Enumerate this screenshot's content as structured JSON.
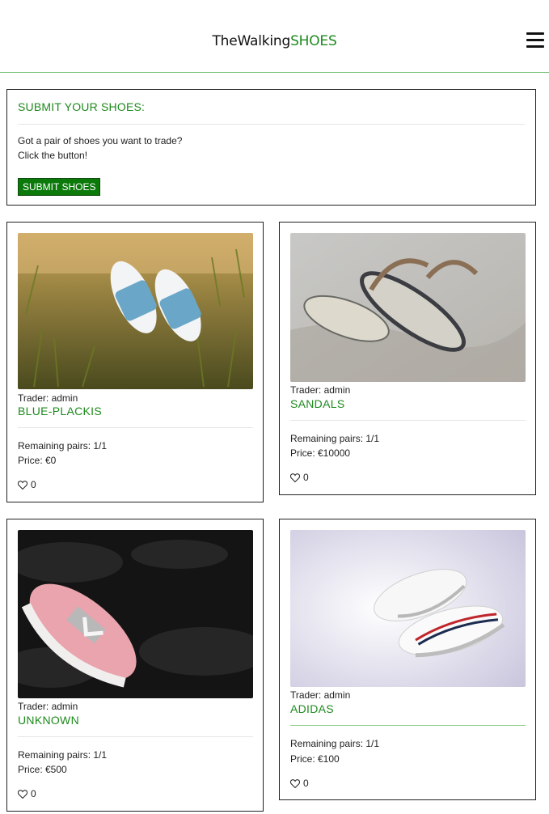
{
  "header": {
    "brand_main": "TheWalking",
    "brand_accent": "SHOES",
    "menu_icon": "hamburger-menu-icon"
  },
  "submit": {
    "title": "SUBMIT YOUR SHOES:",
    "line1": "Got a pair of shoes you want to trade?",
    "line2": "Click the button!",
    "button_label": "SUBMIT SHOES"
  },
  "colors": {
    "accent": "#1d8a1d",
    "button_bg": "#0b7a0b"
  },
  "cards": [
    {
      "trader": "Trader: admin",
      "name": "BLUE-PLACKIS",
      "remaining": "Remaining pairs: 1/1",
      "price": "Price: €0",
      "likes": "0",
      "image": "blue slide sandals on grass"
    },
    {
      "trader": "Trader: admin",
      "name": "SANDALS",
      "remaining": "Remaining pairs: 1/1",
      "price": "Price: €10000",
      "likes": "0",
      "image": "flip-flops on sand"
    },
    {
      "trader": "Trader: admin",
      "name": "UNKNOWN",
      "remaining": "Remaining pairs: 1/1",
      "price": "Price: €500",
      "likes": "0",
      "image": "pink sneaker on dark fabric"
    },
    {
      "trader": "Trader: admin",
      "name": "ADIDAS",
      "remaining": "Remaining pairs: 1/1",
      "price": "Price: €100",
      "likes": "0",
      "image": "white sneakers on light background"
    }
  ]
}
